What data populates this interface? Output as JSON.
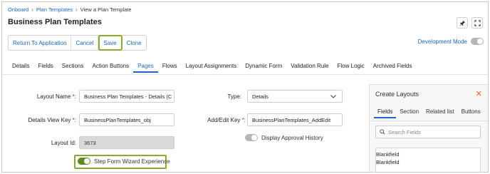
{
  "breadcrumb": {
    "items": [
      "Onboard",
      "Plan Templates",
      "View a Plan Template"
    ]
  },
  "header": {
    "title": "Business Plan Templates"
  },
  "toolbar": {
    "return_label": "Return To Application",
    "cancel_label": "Cancel",
    "save_label": "Save",
    "clone_label": "Clone"
  },
  "dev_mode": {
    "label": "Development Mode",
    "enabled": false
  },
  "tabs": [
    {
      "label": "Details"
    },
    {
      "label": "Fields"
    },
    {
      "label": "Sections"
    },
    {
      "label": "Action Buttons"
    },
    {
      "label": "Pages",
      "active": true
    },
    {
      "label": "Flows"
    },
    {
      "label": "Layout Assignments"
    },
    {
      "label": "Dynamic Form"
    },
    {
      "label": "Validation Rule"
    },
    {
      "label": "Flow Logic"
    },
    {
      "label": "Archived Fields"
    }
  ],
  "form": {
    "layout_name_label": "Layout Name",
    "layout_name_value": "Business Plan Templates - Details (C",
    "details_view_key_label": "Details View Key",
    "details_view_key_value": "BusinessPlanTemplates_obj",
    "layout_id_label": "Layout Id:",
    "layout_id_value": "3673",
    "type_label": "Type:",
    "type_value": "Details",
    "add_edit_key_label": "Add/Edit Key",
    "add_edit_key_value": "BusinessPlanTemplates_AddEdit",
    "approval_history_label": "Display Approval History",
    "approval_history_enabled": false,
    "wizard_label": "Step Form Wizard Experience",
    "wizard_enabled": true,
    "required_mark": "*",
    "colon": ":"
  },
  "panel": {
    "title": "Create Layouts",
    "tabs": [
      "Fields",
      "Section",
      "Related list",
      "Buttons"
    ],
    "search_placeholder": "Search Fields",
    "items": [
      "Blankfield",
      "Blankfield"
    ]
  },
  "colors": {
    "accent": "#1f66c4",
    "highlight": "#8aaa2a",
    "toggle_on": "#5e8a1e",
    "close": "#e2642c"
  }
}
